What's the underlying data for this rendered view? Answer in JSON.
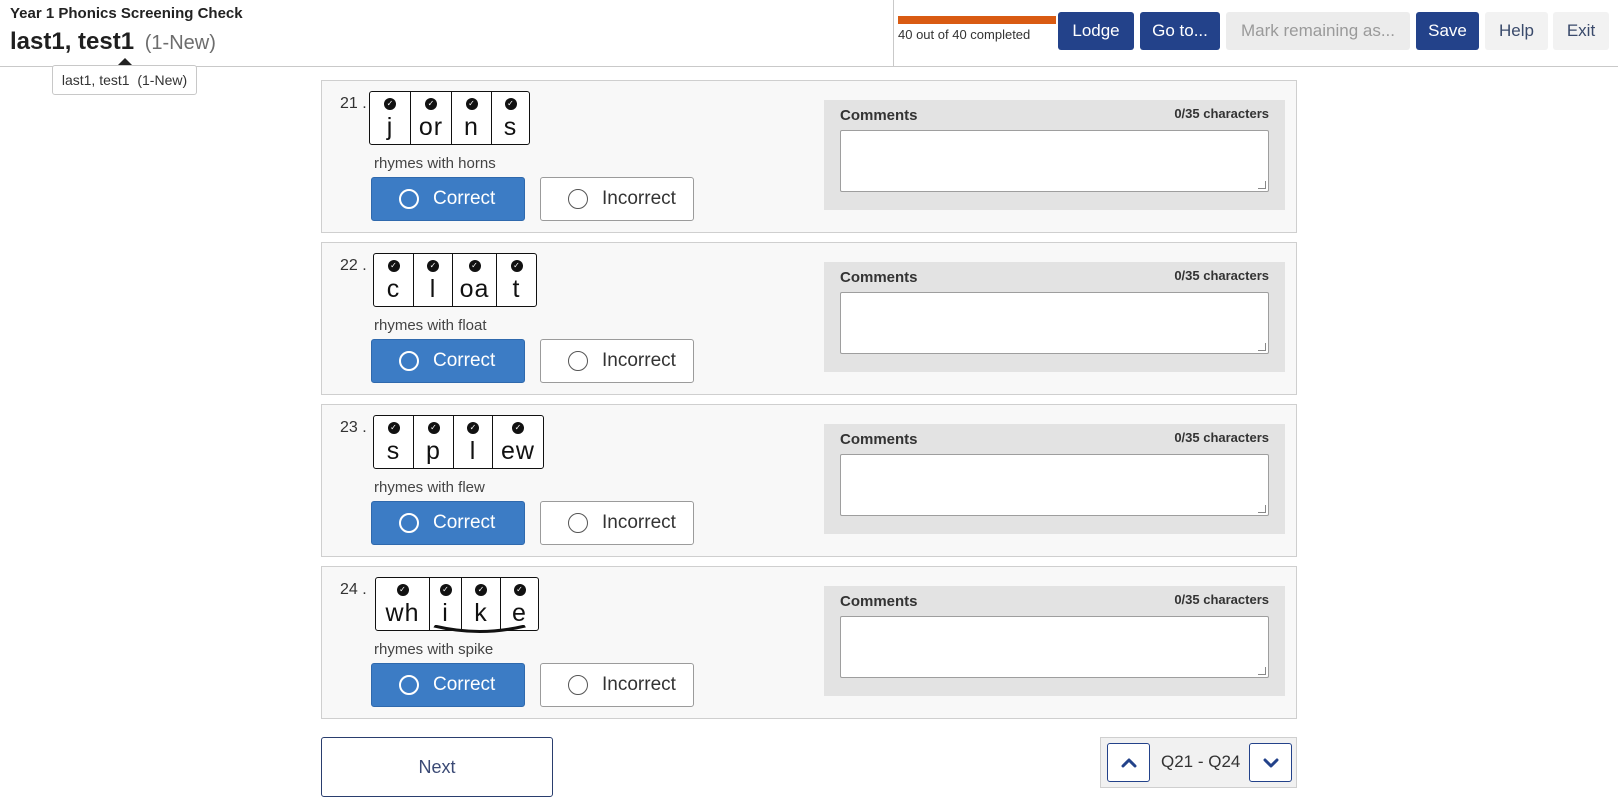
{
  "header": {
    "app_title": "Year 1 Phonics Screening Check",
    "student_name": "last1, test1",
    "student_status": "(1-New)",
    "progress": {
      "completed": 40,
      "total": 40,
      "text": "40 out of 40 completed",
      "fill_color": "#d95b12"
    },
    "buttons": {
      "lodge": "Lodge",
      "goto": "Go to...",
      "mark_remaining": "Mark remaining as...",
      "save": "Save",
      "help": "Help",
      "exit": "Exit"
    },
    "tooltip": "last1, test1  (1-New)"
  },
  "questions": [
    {
      "number": "21 .",
      "graphemes": [
        "j",
        "or",
        "n",
        "s"
      ],
      "split_digraph": false,
      "rhyme": "rhymes with horns",
      "selected": "correct",
      "correct_label": "Correct",
      "incorrect_label": "Incorrect",
      "comments_label": "Comments",
      "comments_count": "0/35 characters",
      "comment": ""
    },
    {
      "number": "22 .",
      "graphemes": [
        "c",
        "l",
        "oa",
        "t"
      ],
      "split_digraph": false,
      "rhyme": "rhymes with float",
      "selected": "correct",
      "correct_label": "Correct",
      "incorrect_label": "Incorrect",
      "comments_label": "Comments",
      "comments_count": "0/35 characters",
      "comment": ""
    },
    {
      "number": "23 .",
      "graphemes": [
        "s",
        "p",
        "l",
        "ew"
      ],
      "split_digraph": false,
      "rhyme": "rhymes with flew",
      "selected": "correct",
      "correct_label": "Correct",
      "incorrect_label": "Incorrect",
      "comments_label": "Comments",
      "comments_count": "0/35 characters",
      "comment": ""
    },
    {
      "number": "24 .",
      "graphemes": [
        "wh",
        "i",
        "k",
        "e"
      ],
      "split_digraph": true,
      "rhyme": "rhymes with spike",
      "selected": "correct",
      "correct_label": "Correct",
      "incorrect_label": "Incorrect",
      "comments_label": "Comments",
      "comments_count": "0/35 characters",
      "comment": ""
    }
  ],
  "footer": {
    "next_label": "Next",
    "pager_label": "Q21 - Q24",
    "prev_icon": "chevron-up-icon",
    "next_icon": "chevron-down-icon"
  },
  "colors": {
    "primary": "#23428a",
    "selected": "#3c7cc5",
    "progress": "#d95b12"
  }
}
